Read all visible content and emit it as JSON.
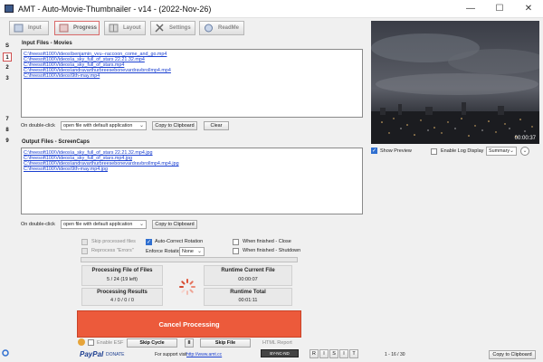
{
  "window": {
    "title": "AMT - Auto-Movie-Thumbnailer - v14 - (2022-Nov-26)",
    "minimize": "—",
    "maximize": "☐",
    "close": "✕"
  },
  "tabs": [
    {
      "label": "Input"
    },
    {
      "label": "Progress"
    },
    {
      "label": "Layout"
    },
    {
      "label": "Settings"
    },
    {
      "label": "ReadMe"
    }
  ],
  "side_buttons": [
    "S",
    "1",
    "2",
    "3",
    "7",
    "8",
    "9"
  ],
  "input_files": {
    "label": "Input Files - Movies",
    "items": [
      "C:\\freesoft100\\Videos\\benjamin_vvu--raccoon_come_and_go.mp4",
      "C:\\freesoft100\\Videos\\a_sky_full_of_stars 22.21.32.mp4",
      "C:\\freesoft100\\Videos\\a_sky_full_of_stars.mp4",
      "C:\\freesoft100\\Videos\\andravarthurbreesebonevardravbrollmp4.mp4",
      "C:\\freesoft100\\Videos\\9th-may.mp4"
    ],
    "double_click_label": "On double-click",
    "double_click_value": "open file with default application",
    "copy_label": "Copy to Clipboard",
    "clear_label": "Clear"
  },
  "output_files": {
    "label": "Output Files - ScreenCaps",
    "items": [
      "C:\\freesoft100\\Videos\\a_sky_full_of_stars 22.21.32.mp4.jpg",
      "C:\\freesoft100\\Videos\\a_sky_full_of_stars.mp4.jpg",
      "C:\\freesoft100\\Videos\\andravarthurbreesebonevardravbrollmp4.mp4.jpg",
      "C:\\freesoft100\\Videos\\9th-may.mp4.jpg"
    ],
    "double_click_label": "On double-click",
    "double_click_value": "open file with default application",
    "copy_label": "Copy to Clipboard"
  },
  "options": {
    "skip_processed": "Skip processed files",
    "reprocess_errors": "Reprocess \"Errors\"",
    "auto_correct_rotation": "Auto-Correct Rotation",
    "enforce_rotation_label": "Enforce Rotation to",
    "enforce_rotation_value": "None",
    "when_finished_close": "When finished - Close",
    "when_finished_shutdown": "When finished - Shutdown"
  },
  "stats": {
    "processing_file_title": "Processing File of Files",
    "processing_file_value": "5 / 24 (19 left)",
    "runtime_current_title": "Runtime Current File",
    "runtime_current_value": "00:00:07",
    "processing_results_title": "Processing Results",
    "processing_results_value": "4 / 0 / 0 / 0",
    "runtime_total_title": "Runtime Total",
    "runtime_total_value": "00:01:11"
  },
  "cancel_label": "Cancel Processing",
  "bottom_bar": {
    "enable_esf": "Enable ESF",
    "skip_cycle": "Skip Cycle",
    "pause_icon": "II",
    "skip_file": "Skip File",
    "html_report": "HTML Report",
    "paypal": "PayPal",
    "donate": "DONATE",
    "support_text": "For support visit",
    "support_url": "http://www.amt.cc",
    "license_badge": "BY-NC-ND",
    "nav_buttons": [
      "R",
      "I",
      "S",
      "I",
      "T"
    ],
    "frame_counter": "1 - 16 / 30",
    "copy_clipboard": "Copy to Clipboard"
  },
  "preview": {
    "timestamp": "00:00:37",
    "show_preview": "Show Preview",
    "enable_log": "Enable Log Display",
    "log_mode": "Summary"
  },
  "colors": {
    "accent": "#2f6fd0",
    "cancel": "#ec5a3b",
    "link": "#1a3fd0"
  }
}
